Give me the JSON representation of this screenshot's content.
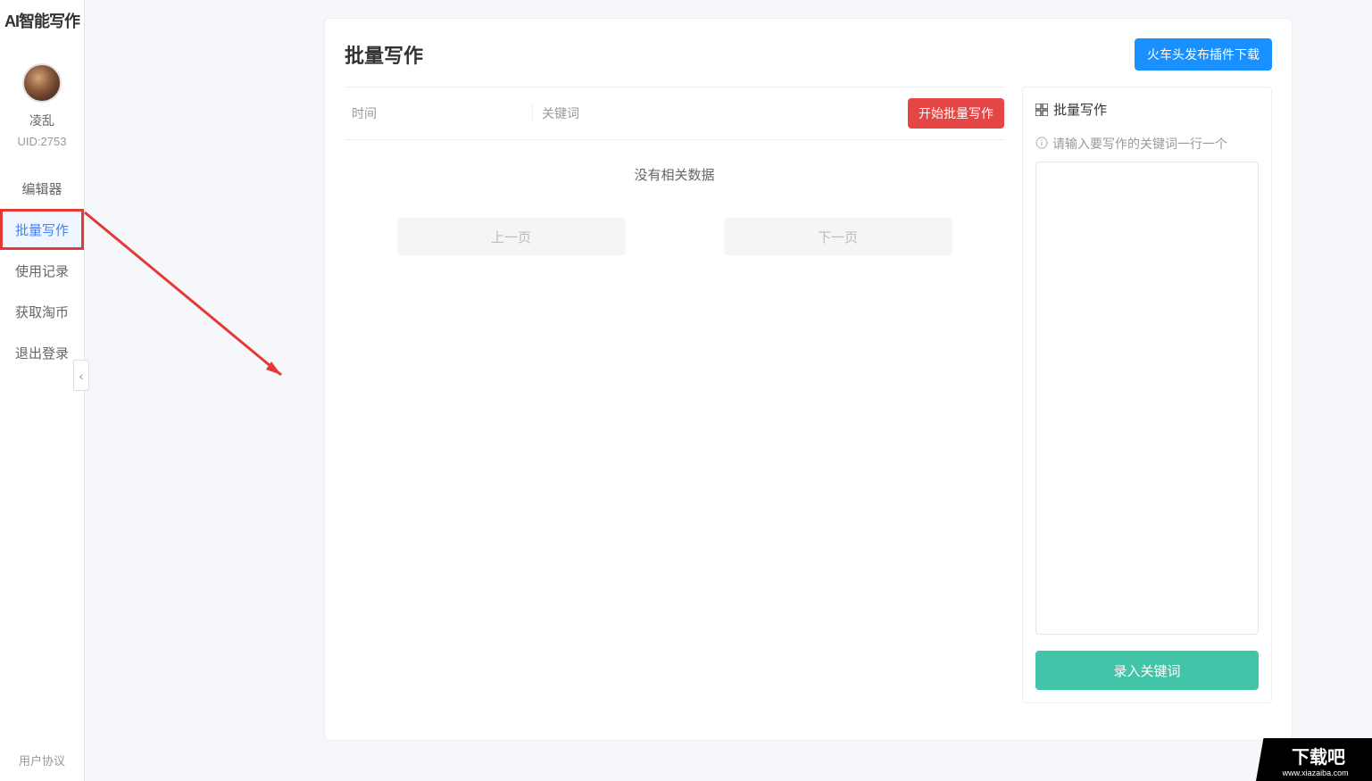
{
  "sidebar": {
    "logo": "AI智能写作",
    "username": "凌乱",
    "uid": "UID:2753",
    "nav": [
      {
        "label": "编辑器"
      },
      {
        "label": "批量写作"
      },
      {
        "label": "使用记录"
      },
      {
        "label": "获取淘币"
      },
      {
        "label": "退出登录"
      }
    ],
    "collapse_icon": "‹",
    "footer_link": "用户协议"
  },
  "main": {
    "title": "批量写作",
    "download_btn": "火车头发布插件下载",
    "table": {
      "th_time": "时间",
      "th_keyword": "关键词",
      "start_btn": "开始批量写作",
      "no_data": "没有相关数据",
      "prev_btn": "上一页",
      "next_btn": "下一页"
    },
    "card": {
      "title": "批量写作",
      "hint": "请输入要写作的关键词一行一个",
      "submit_btn": "录入关键词"
    }
  },
  "watermark": {
    "main": "下载吧",
    "sub": "www.xiazaiba.com"
  },
  "colors": {
    "primary_blue": "#1890ff",
    "danger_red": "#e54545",
    "success_green": "#42c4a8",
    "highlight_border": "#e53935"
  }
}
